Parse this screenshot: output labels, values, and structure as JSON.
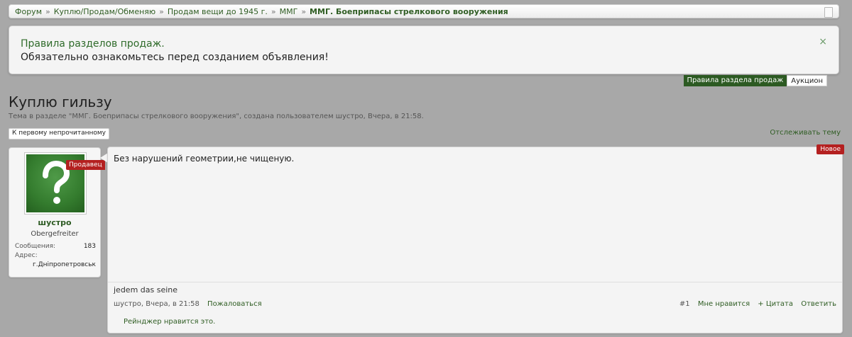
{
  "breadcrumb": {
    "items": [
      "Форум",
      "Куплю/Продам/Обменяю",
      "Продам вещи до 1945 г.",
      "ММГ"
    ],
    "current": "ММГ. Боеприпасы стрелкового вооружения",
    "separator": "»"
  },
  "notice": {
    "title": "Правила разделов продаж.",
    "text": "Обязательно ознакомьтесь перед созданием объявления!",
    "close_glyph": "×"
  },
  "tabs": [
    {
      "label": "Правила раздела продаж",
      "active": true
    },
    {
      "label": "Аукцион",
      "active": false
    }
  ],
  "thread": {
    "title": "Куплю гильзу",
    "description": "Тема в разделе \"ММГ. Боеприпасы стрелкового вооружения\", создана пользователем шустро, Вчера, в 21:58.",
    "unread_button": "К первому непрочитанному",
    "watch_link": "Отслеживать тему"
  },
  "user": {
    "badge": "Продавец",
    "name": "шустро",
    "title": "Obergefreiter",
    "messages_label": "Сообщения:",
    "messages_value": "183",
    "address_label": "Адрес:",
    "address_value": "г.Днiпропетровськ",
    "avatar_glyph": "?"
  },
  "post": {
    "new_badge": "Новое",
    "text": "Без нарушений геометрии,не чищеную.",
    "signature": "jedem das seine",
    "meta": "шустро, Вчера, в 21:58",
    "report": "Пожаловаться",
    "number": "#1",
    "like": "Мне нравится",
    "quote": "+ Цитата",
    "reply": "Ответить",
    "likes_summary": "Рейнджер нравится это."
  },
  "colors": {
    "accent_green": "#2c5a22",
    "badge_red": "#b42020",
    "background": "#a8a8a8"
  }
}
